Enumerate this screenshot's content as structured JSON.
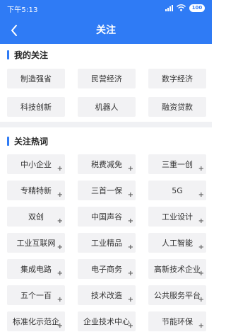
{
  "status_bar": {
    "time": "下午5:13",
    "battery": "100"
  },
  "nav": {
    "title": "关注",
    "back_icon": "chevron-left-icon"
  },
  "my_follow": {
    "title": "我的关注",
    "tags": [
      "制造强省",
      "民营经济",
      "数字经济",
      "科技创新",
      "机器人",
      "融资贷款"
    ]
  },
  "hot_words": {
    "title": "关注热词",
    "add_icon": "plus-icon",
    "tags": [
      "中小企业",
      "税费减免",
      "三重一创",
      "专精特新",
      "三首一保",
      "5G",
      "双创",
      "中国声谷",
      "工业设计",
      "工业互联网",
      "工业精品",
      "人工智能",
      "集成电路",
      "电子商务",
      "高新技术企业",
      "五个一百",
      "技术改造",
      "公共服务平台",
      "标准化示范企",
      "企业技术中心",
      "节能环保"
    ]
  },
  "colors": {
    "accent": "#2f7bf5",
    "tag_bg": "#f2f2f4",
    "divider": "#f0f1f4"
  }
}
